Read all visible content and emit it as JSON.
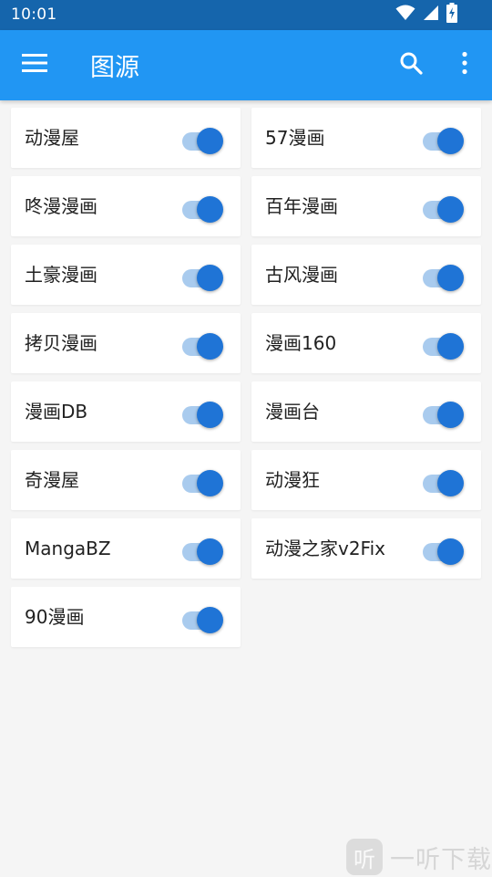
{
  "status_bar": {
    "time": "10:01",
    "icons": [
      "wifi-icon",
      "cell-signal-icon",
      "battery-charging-icon"
    ]
  },
  "app_bar": {
    "title": "图源",
    "left_icon": "menu-icon",
    "right_icons": [
      "search-icon",
      "more-vert-icon"
    ]
  },
  "colors": {
    "status_bar": "#1565ac",
    "app_bar": "#2196f3",
    "background": "#f5f5f5",
    "toggle_thumb": "#1f74d6",
    "toggle_track": "#a9cbee"
  },
  "sources": [
    {
      "name": "动漫屋",
      "enabled": true
    },
    {
      "name": "57漫画",
      "enabled": true
    },
    {
      "name": "咚漫漫画",
      "enabled": true
    },
    {
      "name": "百年漫画",
      "enabled": true
    },
    {
      "name": "土豪漫画",
      "enabled": true
    },
    {
      "name": "古风漫画",
      "enabled": true
    },
    {
      "name": "拷贝漫画",
      "enabled": true
    },
    {
      "name": "漫画160",
      "enabled": true
    },
    {
      "name": "漫画DB",
      "enabled": true
    },
    {
      "name": "漫画台",
      "enabled": true
    },
    {
      "name": "奇漫屋",
      "enabled": true
    },
    {
      "name": "动漫狂",
      "enabled": true
    },
    {
      "name": "MangaBZ",
      "enabled": true
    },
    {
      "name": "动漫之家v2Fix",
      "enabled": true
    },
    {
      "name": "90漫画",
      "enabled": true
    }
  ],
  "watermark": {
    "logo_char": "听",
    "text": "一听下载"
  }
}
